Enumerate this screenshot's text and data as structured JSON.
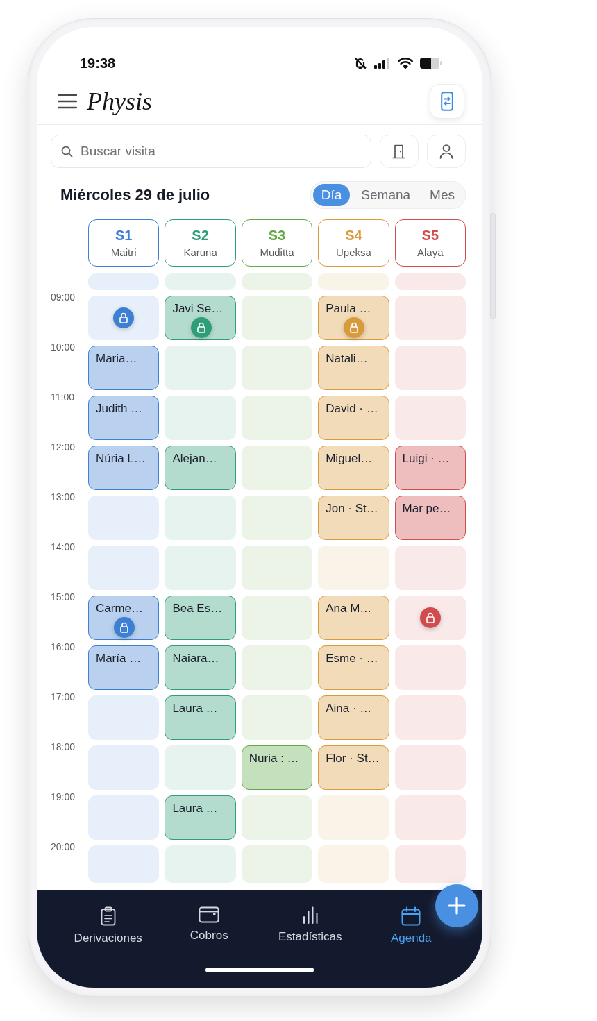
{
  "status_bar": {
    "time": "19:38"
  },
  "header": {
    "title": "Physis"
  },
  "search": {
    "placeholder": "Buscar visita"
  },
  "date": "Miércoles 29 de julio",
  "views": [
    {
      "label": "Día",
      "selected": true
    },
    {
      "label": "Semana",
      "selected": false
    },
    {
      "label": "Mes",
      "selected": false
    }
  ],
  "times": [
    "09:00",
    "10:00",
    "11:00",
    "12:00",
    "13:00",
    "14:00",
    "15:00",
    "16:00",
    "17:00",
    "18:00",
    "19:00",
    "20:00"
  ],
  "rooms": [
    {
      "code": "S1",
      "name": "Maitri",
      "color": "#3d7fd3",
      "slots": [
        {
          "kind": "free",
          "locked": false
        },
        {
          "kind": "free",
          "locked": true
        },
        {
          "kind": "visit",
          "patient": "Maria…",
          "locked": false
        },
        {
          "kind": "visit",
          "patient": "Judith …",
          "locked": false
        },
        {
          "kind": "visit",
          "patient": "Núria L…",
          "locked": false
        },
        {
          "kind": "free",
          "locked": false
        },
        {
          "kind": "free",
          "locked": false
        },
        {
          "kind": "visit",
          "patient": "Carme…",
          "locked": true
        },
        {
          "kind": "visit",
          "patient": "María …",
          "locked": false
        },
        {
          "kind": "free",
          "locked": false
        },
        {
          "kind": "free",
          "locked": false
        },
        {
          "kind": "free",
          "locked": false
        },
        {
          "kind": "free",
          "locked": false
        }
      ]
    },
    {
      "code": "S2",
      "name": "Karuna",
      "color": "#2e9e78",
      "slots": [
        {
          "kind": "free",
          "locked": false
        },
        {
          "kind": "visit",
          "patient": "Javi Se…",
          "locked": true
        },
        {
          "kind": "free",
          "locked": false
        },
        {
          "kind": "free",
          "locked": false
        },
        {
          "kind": "visit",
          "patient": "Alejan…",
          "locked": false
        },
        {
          "kind": "free",
          "locked": false
        },
        {
          "kind": "free",
          "locked": false
        },
        {
          "kind": "visit",
          "patient": "Bea Es…",
          "locked": false
        },
        {
          "kind": "visit",
          "patient": "Naiara…",
          "locked": false
        },
        {
          "kind": "visit",
          "patient": "Laura …",
          "locked": false
        },
        {
          "kind": "free",
          "locked": false
        },
        {
          "kind": "visit",
          "patient": "Laura …",
          "locked": false
        },
        {
          "kind": "free",
          "locked": false
        }
      ]
    },
    {
      "code": "S3",
      "name": "Muditta",
      "color": "#5fa844",
      "slots": [
        {
          "kind": "free",
          "locked": false
        },
        {
          "kind": "free",
          "locked": false
        },
        {
          "kind": "free",
          "locked": false
        },
        {
          "kind": "free",
          "locked": false
        },
        {
          "kind": "free",
          "locked": false
        },
        {
          "kind": "free",
          "locked": false
        },
        {
          "kind": "free",
          "locked": false
        },
        {
          "kind": "free",
          "locked": false
        },
        {
          "kind": "free",
          "locked": false
        },
        {
          "kind": "free",
          "locked": false
        },
        {
          "kind": "visit",
          "patient": "Nuria : …",
          "locked": false
        },
        {
          "kind": "free",
          "locked": false
        },
        {
          "kind": "free",
          "locked": false
        }
      ]
    },
    {
      "code": "S4",
      "name": "Upeksa",
      "color": "#d99a3c",
      "slots": [
        {
          "kind": "free",
          "locked": false
        },
        {
          "kind": "visit",
          "patient": "Paula …",
          "locked": true
        },
        {
          "kind": "visit",
          "patient": "Natali…",
          "locked": false
        },
        {
          "kind": "visit",
          "patient": "David · …",
          "locked": false
        },
        {
          "kind": "visit",
          "patient": "Miguel…",
          "locked": false
        },
        {
          "kind": "visit",
          "patient": "Jon · St…",
          "locked": false
        },
        {
          "kind": "free",
          "locked": false
        },
        {
          "kind": "visit",
          "patient": "Ana M…",
          "locked": false
        },
        {
          "kind": "visit",
          "patient": "Esme · …",
          "locked": false
        },
        {
          "kind": "visit",
          "patient": "Aina · …",
          "locked": false
        },
        {
          "kind": "visit",
          "patient": "Flor · St…",
          "locked": false
        },
        {
          "kind": "free",
          "locked": false
        },
        {
          "kind": "free",
          "locked": false
        }
      ]
    },
    {
      "code": "S5",
      "name": "Alaya",
      "color": "#d14c4c",
      "slots": [
        {
          "kind": "free",
          "locked": false
        },
        {
          "kind": "free",
          "locked": false
        },
        {
          "kind": "free",
          "locked": false
        },
        {
          "kind": "free",
          "locked": false
        },
        {
          "kind": "visit",
          "patient": "Luigi · …",
          "locked": false
        },
        {
          "kind": "visit",
          "patient": "Mar pe…",
          "locked": false
        },
        {
          "kind": "free",
          "locked": false
        },
        {
          "kind": "free",
          "locked": true
        },
        {
          "kind": "free",
          "locked": false
        },
        {
          "kind": "free",
          "locked": false
        },
        {
          "kind": "free",
          "locked": false
        },
        {
          "kind": "free",
          "locked": false
        },
        {
          "kind": "free",
          "locked": false
        }
      ]
    }
  ],
  "nav": [
    {
      "label": "Derivaciones",
      "selected": false
    },
    {
      "label": "Cobros",
      "selected": false
    },
    {
      "label": "Estadísticas",
      "selected": false
    },
    {
      "label": "Agenda",
      "selected": true
    }
  ]
}
